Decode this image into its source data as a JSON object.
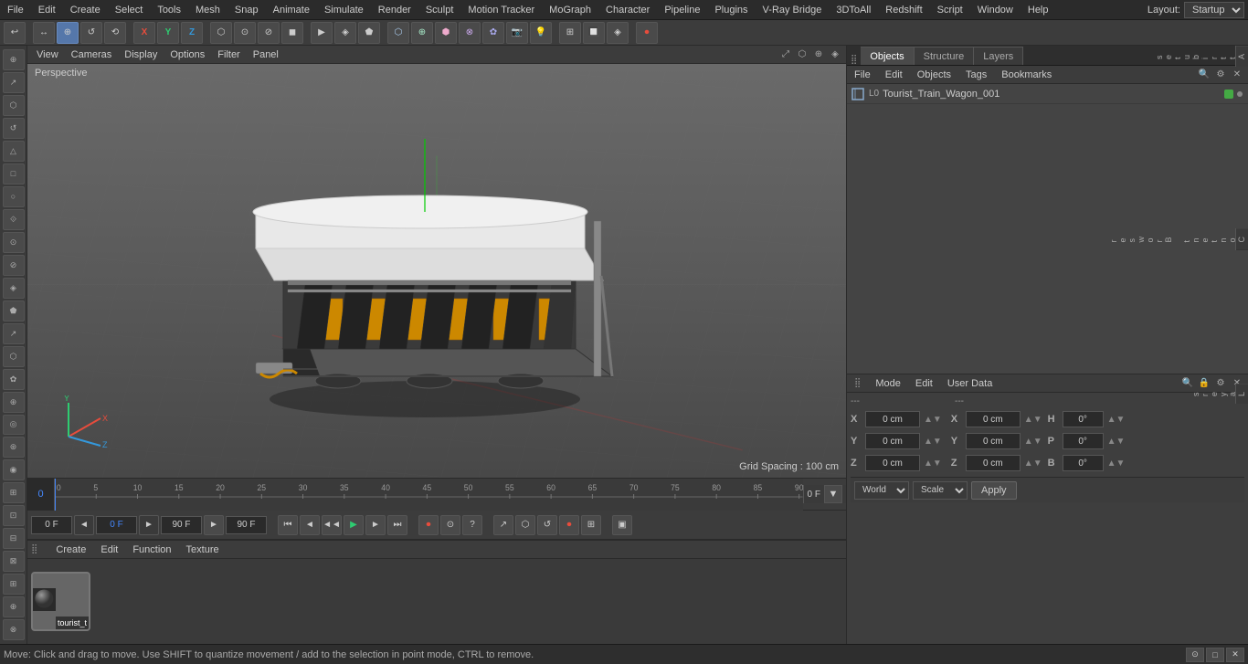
{
  "menubar": {
    "items": [
      "File",
      "Edit",
      "Create",
      "Select",
      "Tools",
      "Mesh",
      "Snap",
      "Animate",
      "Simulate",
      "Render",
      "Sculpt",
      "Motion Tracker",
      "MoGraph",
      "Character",
      "Pipeline",
      "Plugins",
      "V-Ray Bridge",
      "3DToAll",
      "Redshift",
      "Script",
      "Window",
      "Help"
    ],
    "layout_label": "Layout:",
    "layout_value": "Startup"
  },
  "toolbar": {
    "tools": [
      "↩",
      "↔",
      "⬡",
      "✦",
      "↗",
      "⊕",
      "⊗",
      "⊞",
      "🔲",
      "▶",
      "◈",
      "⬢",
      "⬟",
      "✿",
      "⊙",
      "📷",
      "💡"
    ]
  },
  "viewport": {
    "perspective_label": "Perspective",
    "grid_spacing": "Grid Spacing : 100 cm",
    "menus": [
      "View",
      "Cameras",
      "Display",
      "Options",
      "Filter",
      "Panel"
    ]
  },
  "timeline": {
    "ticks": [
      "0",
      "5",
      "10",
      "15",
      "20",
      "25",
      "30",
      "35",
      "40",
      "45",
      "50",
      "55",
      "60",
      "65",
      "70",
      "75",
      "80",
      "85",
      "90"
    ],
    "current_frame": "0 F",
    "frame_badge": "0"
  },
  "transport": {
    "fields": [
      "0 F",
      "0 F",
      "90 F",
      "90 F"
    ],
    "frame_display": "0 F"
  },
  "object_manager": {
    "tabs": [
      "Objects",
      "Structure",
      "Layers"
    ],
    "active_tab": "Objects",
    "menus": [
      "File",
      "Edit",
      "Objects",
      "Tags",
      "Bookmarks"
    ],
    "objects": [
      {
        "name": "Tourist_Train_Wagon_001",
        "type": "object",
        "badge_color": "#44aa44"
      }
    ]
  },
  "attributes": {
    "menus": [
      "Mode",
      "Edit",
      "User Data"
    ],
    "coords": {
      "x_pos": "0 cm",
      "y_pos": "0 cm",
      "z_pos": "0 cm",
      "x_rot": "0°",
      "y_rot": "0°",
      "z_rot": "0°",
      "w": "0 cm",
      "h": "0 cm",
      "b": "0°",
      "p": "0°",
      "size_x": "0 cm",
      "size_y": "0 cm",
      "size_z": "0 cm"
    }
  },
  "coord_strip": {
    "world_label": "World",
    "scale_label": "Scale",
    "apply_label": "Apply"
  },
  "material_editor": {
    "menus": [
      "Create",
      "Edit",
      "Function",
      "Texture"
    ],
    "material_name": "tourist_t"
  },
  "status_bar": {
    "text": "Move: Click and drag to move. Use SHIFT to quantize movement / add to the selection in point mode, CTRL to remove."
  },
  "right_tabs": {
    "tabs": [
      "Attributes",
      "Layers"
    ]
  },
  "side_tools": {
    "groups": [
      [
        "⬡",
        "⊕",
        "⬢",
        "⊗"
      ],
      [
        "△",
        "□",
        "○",
        "⟐"
      ],
      [
        "⊙",
        "⊘",
        "◈",
        "⬟"
      ],
      [
        "↗",
        "⬡",
        "✿",
        "⊕"
      ],
      [
        "◎",
        "⊛",
        "◉",
        "⊞"
      ],
      [
        "⊡",
        "⊟",
        "⊠",
        "⊞"
      ],
      [
        "⊕",
        "⊗"
      ]
    ]
  }
}
